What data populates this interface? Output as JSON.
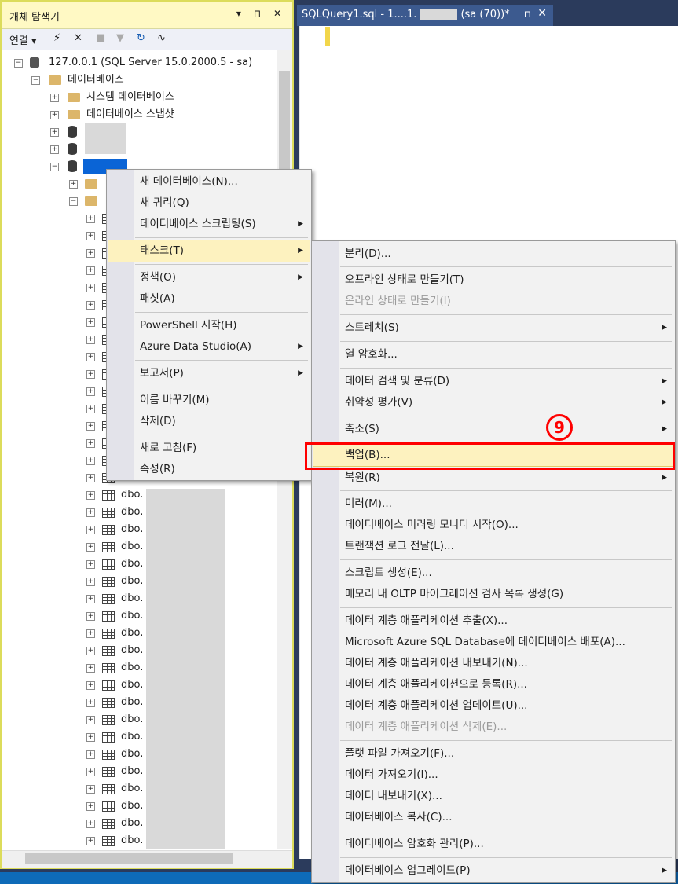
{
  "object_explorer": {
    "title": "개체 탐색기",
    "title_buttons": "▾ ⊓ ✕",
    "toolbar": {
      "connect_label": "연결"
    },
    "server_node": "127.0.0.1 (SQL Server 15.0.2000.5 - sa)",
    "databases_node": "데이터베이스",
    "system_databases": "시스템 데이터베이스",
    "database_snapshots": "데이터베이스 스냅샷",
    "table_prefix": "dbo."
  },
  "editor": {
    "tab_title": "SQLQuery1.sql - 1....1.",
    "tab_suffix": "(sa (70))*",
    "tab_pin": "⊓",
    "tab_close": "✕"
  },
  "context_menu": {
    "items": [
      {
        "label": "새 데이터베이스(N)..."
      },
      {
        "label": "새 쿼리(Q)"
      },
      {
        "label": "데이터베이스 스크립팅(S)",
        "submenu": true
      },
      {
        "label": "태스크(T)",
        "submenu": true,
        "highlighted": true
      },
      {
        "label": "정책(O)",
        "submenu": true
      },
      {
        "label": "패싯(A)"
      },
      {
        "label": "PowerShell 시작(H)"
      },
      {
        "label": "Azure Data Studio(A)",
        "submenu": true
      },
      {
        "label": "보고서(P)",
        "submenu": true
      },
      {
        "label": "이름 바꾸기(M)"
      },
      {
        "label": "삭제(D)"
      },
      {
        "label": "새로 고침(F)"
      },
      {
        "label": "속성(R)"
      }
    ]
  },
  "tasks_menu": {
    "items": [
      {
        "label": "분리(D)..."
      },
      {
        "label": "오프라인 상태로 만들기(T)"
      },
      {
        "label": "온라인 상태로 만들기(I)",
        "disabled": true
      },
      {
        "label": "스트레치(S)",
        "submenu": true
      },
      {
        "label": "열 암호화..."
      },
      {
        "label": "데이터 검색 및 분류(D)",
        "submenu": true
      },
      {
        "label": "취약성 평가(V)",
        "submenu": true
      },
      {
        "label": "축소(S)",
        "submenu": true
      },
      {
        "label": "백업(B)...",
        "highlighted": true
      },
      {
        "label": "복원(R)",
        "submenu": true
      },
      {
        "label": "미러(M)..."
      },
      {
        "label": "데이터베이스 미러링 모니터 시작(O)..."
      },
      {
        "label": "트랜잭션 로그 전달(L)..."
      },
      {
        "label": "스크립트 생성(E)..."
      },
      {
        "label": "메모리 내 OLTP 마이그레이션 검사 목록 생성(G)"
      },
      {
        "label": "데이터 계층 애플리케이션 추출(X)..."
      },
      {
        "label": "Microsoft Azure SQL Database에 데이터베이스 배포(A)..."
      },
      {
        "label": "데이터 계층 애플리케이션 내보내기(N)..."
      },
      {
        "label": "데이터 계층 애플리케이션으로 등록(R)..."
      },
      {
        "label": "데이터 계층 애플리케이션 업데이트(U)..."
      },
      {
        "label": "데이터 계층 애플리케이션 삭제(E)...",
        "disabled": true
      },
      {
        "label": "플랫 파일 가져오기(F)..."
      },
      {
        "label": "데이터 가져오기(I)..."
      },
      {
        "label": "데이터 내보내기(X)..."
      },
      {
        "label": "데이터베이스 복사(C)..."
      },
      {
        "label": "데이터베이스 암호화 관리(P)..."
      },
      {
        "label": "데이터베이스 업그레이드(P)",
        "submenu": true
      }
    ]
  },
  "annotation": {
    "step_marker": "9"
  },
  "colors": {
    "highlight": "#fdf2bf",
    "annotation_red": "#ff0000",
    "titlebar": "#fff9c4"
  }
}
